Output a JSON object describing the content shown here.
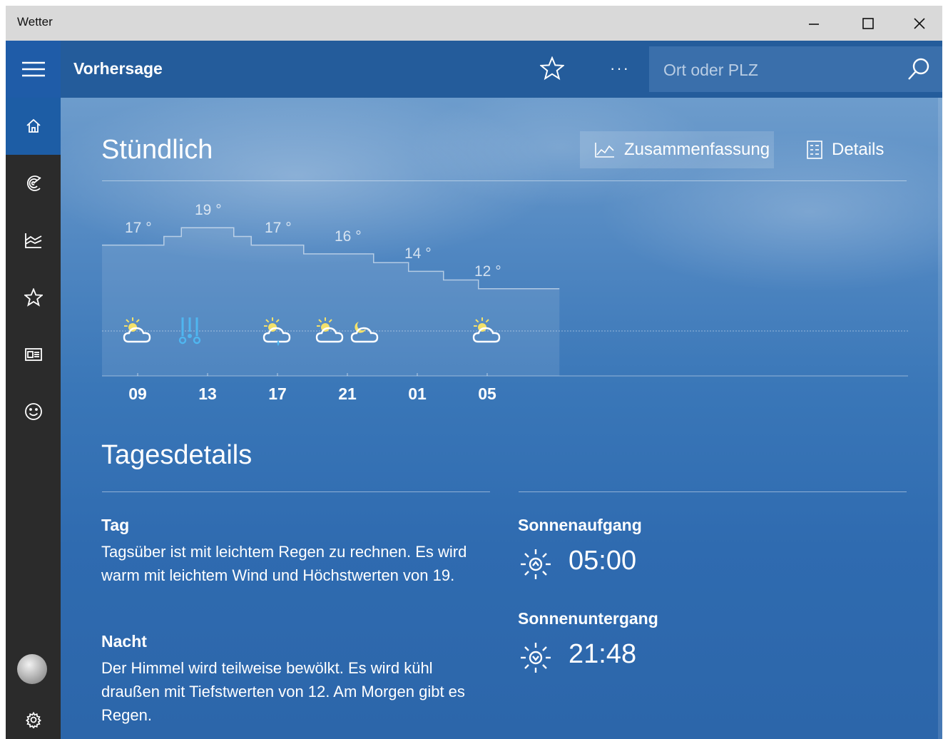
{
  "window": {
    "title": "Wetter",
    "controls": [
      "minimize",
      "maximize",
      "close"
    ]
  },
  "topbar": {
    "title": "Vorhersage",
    "menu_icon": "hamburger-icon",
    "favorite_icon": "star-icon",
    "more_label": "···",
    "search": {
      "placeholder": "Ort oder PLZ",
      "value": "",
      "icon": "search-icon"
    }
  },
  "sidebar": {
    "items": [
      {
        "icon": "home-icon",
        "active": true
      },
      {
        "icon": "radar-icon",
        "active": false
      },
      {
        "icon": "historical-chart-icon",
        "active": false
      },
      {
        "icon": "star-icon",
        "active": false
      },
      {
        "icon": "news-icon",
        "active": false
      },
      {
        "icon": "smiley-icon",
        "active": false
      }
    ],
    "bottom": [
      {
        "icon": "avatar"
      },
      {
        "icon": "gear-icon"
      }
    ]
  },
  "hourly": {
    "title": "Stündlich",
    "view_buttons": [
      {
        "label": "Zusammenfassung",
        "icon": "chart-icon",
        "selected": true
      },
      {
        "label": "Details",
        "icon": "details-list-icon",
        "selected": false
      }
    ]
  },
  "chart_data": {
    "type": "line",
    "x_ticks": [
      "09",
      "13",
      "17",
      "21",
      "01",
      "05"
    ],
    "temperature_labels": [
      {
        "hour": "09",
        "value": "17 °"
      },
      {
        "hour": "13",
        "value": "19 °"
      },
      {
        "hour": "17",
        "value": "17 °"
      },
      {
        "hour": "21",
        "value": "16 °"
      },
      {
        "hour": "01",
        "value": "14 °"
      },
      {
        "hour": "05",
        "value": "12 °"
      }
    ],
    "hours": [
      9,
      10,
      11,
      12,
      13,
      14,
      15,
      16,
      17,
      18,
      19,
      20,
      21,
      22,
      23,
      0,
      1,
      2,
      3,
      4,
      5,
      6,
      7
    ],
    "temperatures": [
      17,
      17,
      18,
      19,
      19,
      19,
      18,
      17,
      17,
      17,
      16,
      16,
      16,
      16,
      15,
      15,
      14,
      14,
      13,
      13,
      12,
      12,
      12
    ],
    "condition_icons": [
      {
        "hour": "09",
        "icon": "partly-cloudy-icon"
      },
      {
        "hour": "12",
        "icon": "rain-icon"
      },
      {
        "hour": "17",
        "icon": "partly-cloudy-rain-icon"
      },
      {
        "hour": "20",
        "icon": "partly-cloudy-icon"
      },
      {
        "hour": "22",
        "icon": "partly-cloudy-night-icon"
      },
      {
        "hour": "05",
        "icon": "partly-cloudy-icon"
      }
    ],
    "grid": false,
    "accent": "#ffffff"
  },
  "day_details": {
    "title": "Tagesdetails",
    "day_title": "Tag",
    "day_text": "Tagsüber ist mit leichtem Regen zu rechnen. Es wird warm mit leichtem Wind und Höchstwerten von 19.",
    "night_title": "Nacht",
    "night_text": "Der Himmel wird teilweise bewölkt. Es wird kühl draußen mit Tiefstwerten von 12. Am Morgen gibt es Regen.",
    "sunrise_label": "Sonnenaufgang",
    "sunrise_time": "05:00",
    "sunset_label": "Sonnenuntergang",
    "sunset_time": "21:48"
  },
  "colors": {
    "titlebar": "#d9d9d9",
    "topbar": "#245c9b",
    "sidebar": "#2b2b2b",
    "sidebar_active": "#1d5da5",
    "search_bg": "#3a6fab",
    "sun_yellow": "#f3e16b",
    "rain_blue": "#4fb6f0"
  }
}
